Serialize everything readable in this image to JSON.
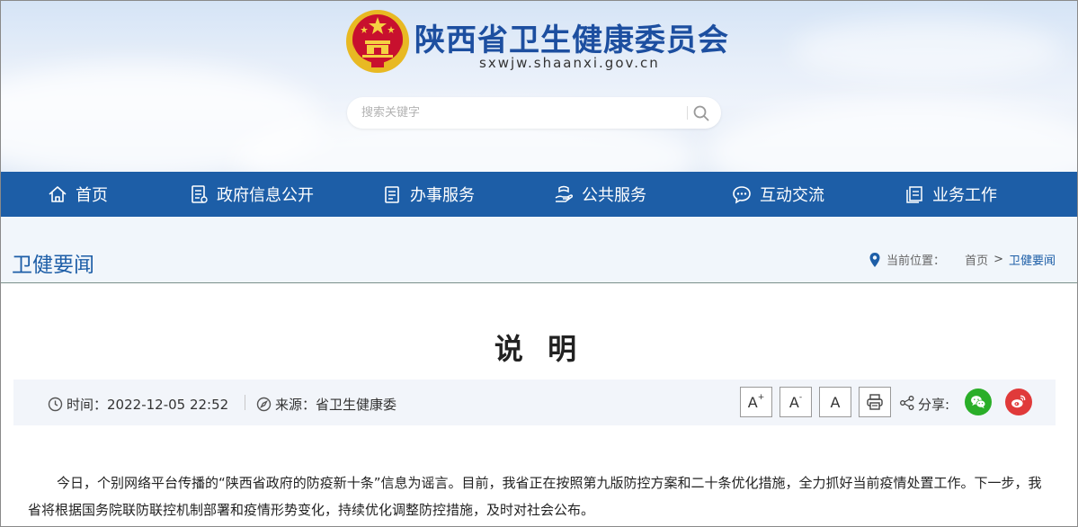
{
  "header": {
    "site_title": "陕西省卫生健康委员会",
    "site_domain": "sxwjw.shaanxi.gov.cn",
    "emblem_icon": "national-emblem-icon"
  },
  "search": {
    "placeholder": "搜索关键字",
    "button_icon": "search-icon"
  },
  "nav": {
    "items": [
      {
        "label": "首页",
        "icon": "home-icon"
      },
      {
        "label": "政府信息公开",
        "icon": "document-list-icon"
      },
      {
        "label": "办事服务",
        "icon": "clipboard-icon"
      },
      {
        "label": "公共服务",
        "icon": "hand-service-icon"
      },
      {
        "label": "互动交流",
        "icon": "chat-bubble-icon"
      },
      {
        "label": "业务工作",
        "icon": "folder-stack-icon"
      }
    ]
  },
  "section": {
    "title": "卫健要闻",
    "location_label": "当前位置：",
    "crumb_home": "首页",
    "crumb_arrow": ">",
    "crumb_current": "卫健要闻"
  },
  "article": {
    "title": "说 明",
    "time_label": "时间：",
    "time_value": "2022-12-05 22:52",
    "source_label": "来源：",
    "source_value": "省卫生健康委",
    "font_large": "A",
    "font_large_sup": "+",
    "font_small": "A",
    "font_small_sup": "-",
    "font_default": "A",
    "share_label": "分享:",
    "body": "今日，个别网络平台传播的“陕西省政府的防疫新十条”信息为谣言。目前，我省正在按照第九版防控方案和二十条优化措施，全力抓好当前疫情处置工作。下一步，我省将根据国务院联防联控机制部署和疫情形势变化，持续优化调整防控措施，及时对社会公布。"
  },
  "colors": {
    "primary_blue": "#1d5ea7",
    "title_blue": "#1d4fa0",
    "wechat_green": "#2aae28",
    "weibo_red": "#e03a3a",
    "meta_bg": "#f2f5fa"
  }
}
